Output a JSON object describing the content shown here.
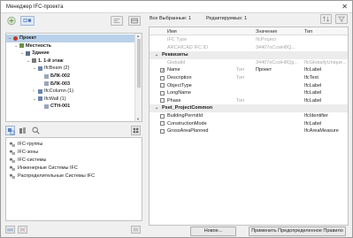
{
  "window": {
    "title": "Менеджер IFC-проекта",
    "close_glyph": "✕"
  },
  "tree": {
    "items": [
      {
        "label": "Проект",
        "indent": 0,
        "arrow": "⌄",
        "icon": "project-icon",
        "selected": true,
        "bold": true
      },
      {
        "label": "Местность",
        "indent": 1,
        "arrow": "⌄",
        "icon": "site-icon",
        "bold": true
      },
      {
        "label": "Здание",
        "indent": 2,
        "arrow": "⌄",
        "icon": "building-icon",
        "bold": true
      },
      {
        "label": "1. 1-й этаж",
        "indent": 3,
        "arrow": "⌄",
        "icon": "storey-icon",
        "bold": true
      },
      {
        "label": "IfcBeam (2)",
        "indent": 4,
        "arrow": "⌄",
        "icon": "element-group-icon"
      },
      {
        "label": "БЛК-002",
        "indent": 5,
        "arrow": "",
        "icon": "element-icon",
        "bold": true
      },
      {
        "label": "БЛК-003",
        "indent": 5,
        "arrow": "",
        "icon": "element-icon",
        "bold": true
      },
      {
        "label": "IfcColumn (1)",
        "indent": 4,
        "arrow": "›",
        "icon": "element-group-icon"
      },
      {
        "label": "IfcWall (1)",
        "indent": 4,
        "arrow": "⌄",
        "icon": "element-group-icon"
      },
      {
        "label": "СТН-001",
        "indent": 5,
        "arrow": "",
        "icon": "element-icon",
        "bold": true
      }
    ]
  },
  "lower_list": {
    "items": [
      {
        "label": "IFC-группы",
        "icon": "groups-icon"
      },
      {
        "label": "IFC-зоны",
        "icon": "zones-icon"
      },
      {
        "label": "IFC-системы",
        "icon": "systems-icon"
      },
      {
        "label": "Инженерные Системы IFC",
        "icon": "mep-systems-icon"
      },
      {
        "label": "Распределительные Системы IFC",
        "icon": "distribution-systems-icon"
      }
    ]
  },
  "info": {
    "selected_label": "Все Выбранные: 1",
    "editable_label": "Редактируемых: 1"
  },
  "grid": {
    "headers": {
      "name": "Имя",
      "value": "Значение",
      "type": "Тип"
    },
    "rows": [
      {
        "kind": "prop",
        "name": "IFC Type",
        "value": "IfcProject",
        "type": "",
        "muted": true,
        "checkbox": false
      },
      {
        "kind": "prop",
        "name": "ARCHICAD IFC ID",
        "value": "34407oCcwH8Q...",
        "type": "",
        "muted": true,
        "checkbox": false
      },
      {
        "kind": "group",
        "name": "Реквизиты"
      },
      {
        "kind": "prop",
        "name": "GlobalId",
        "value": "34407oCcwH8Qg...",
        "type": "IfcGloballyUnique...",
        "muted": true,
        "checkbox": false
      },
      {
        "kind": "prop",
        "name": "Name",
        "value": "Проект",
        "vtag": "Тип",
        "type": "IfcLabel",
        "checkbox": true,
        "checked": true
      },
      {
        "kind": "prop",
        "name": "Description",
        "value": "",
        "vtag": "Тип",
        "type": "IfcText",
        "checkbox": true
      },
      {
        "kind": "prop",
        "name": "ObjectType",
        "value": "",
        "type": "IfcLabel",
        "checkbox": true
      },
      {
        "kind": "prop",
        "name": "LongName",
        "value": "",
        "type": "IfcLabel",
        "checkbox": true
      },
      {
        "kind": "prop",
        "name": "Phase",
        "value": "",
        "vtag": "Тип",
        "type": "IfcLabel",
        "checkbox": true
      },
      {
        "kind": "group",
        "name": "Pset_ProjectCommon"
      },
      {
        "kind": "prop",
        "name": "BuildingPermitId",
        "value": "",
        "type": "IfcIdentifier",
        "checkbox": true
      },
      {
        "kind": "prop",
        "name": "ConstructionMode",
        "value": "",
        "type": "IfcLabel",
        "checkbox": true
      },
      {
        "kind": "prop",
        "name": "GrossAreaPlanned",
        "value": "",
        "type": "IfcAreaMeasure",
        "checkbox": true
      }
    ]
  },
  "buttons": {
    "new": "Новое...",
    "apply": "Применить Предопределенное Правило"
  }
}
